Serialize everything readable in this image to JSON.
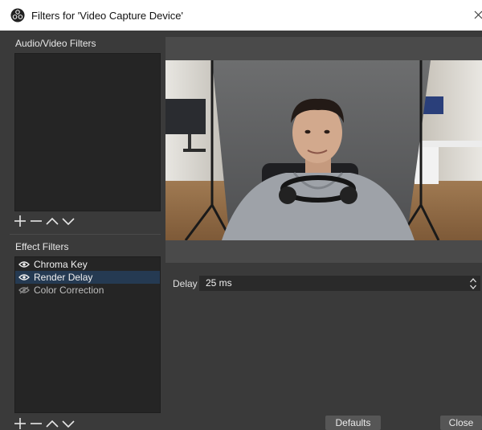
{
  "window": {
    "title": "Filters for 'Video Capture Device'"
  },
  "audio_video_filters": {
    "label": "Audio/Video Filters",
    "items": []
  },
  "effect_filters": {
    "label": "Effect Filters",
    "items": [
      {
        "label": "Chroma Key",
        "enabled": true,
        "selected": false
      },
      {
        "label": "Render Delay",
        "enabled": true,
        "selected": true
      },
      {
        "label": "Color Correction",
        "enabled": false,
        "selected": false
      }
    ]
  },
  "properties": {
    "delay_label": "Delay",
    "delay_value": "25 ms"
  },
  "buttons": {
    "defaults": "Defaults",
    "close": "Close"
  },
  "colors": {
    "background": "#3a3a3a",
    "list_bg": "#252525",
    "selected_row": "#253a52",
    "titlebar": "#ffffff"
  },
  "icons": {
    "add": "plus-icon",
    "remove": "minus-icon",
    "up": "chevron-up-icon",
    "down": "chevron-down-icon",
    "visibility": "eye-icon"
  }
}
